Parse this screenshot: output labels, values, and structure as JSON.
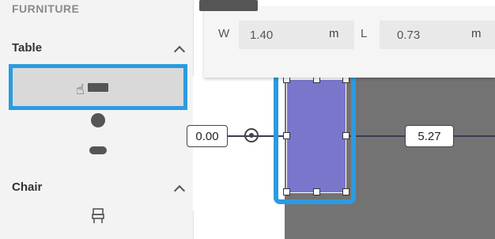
{
  "sidebar": {
    "section_title": "FURNITURE",
    "groups": [
      {
        "label": "Table",
        "expanded": true,
        "items": [
          "rectangle-table",
          "round-table",
          "oval-table"
        ],
        "selected_index": 0
      },
      {
        "label": "Chair",
        "expanded": true,
        "items": [
          "chair"
        ]
      }
    ]
  },
  "toolbar": {
    "width_label": "W",
    "width_value": "1.40",
    "width_unit": "m",
    "length_label": "L",
    "length_value": "0.73",
    "length_unit": "m"
  },
  "canvas": {
    "left_dimension": "0.00",
    "right_dimension": "5.27"
  },
  "colors": {
    "accent": "#2b9be0",
    "table_fill": "#7a76cc",
    "floor": "#737373",
    "wall_line": "#dd2222"
  }
}
